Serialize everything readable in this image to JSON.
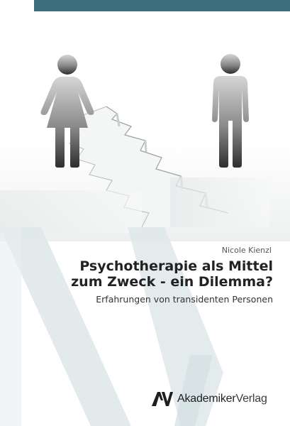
{
  "cover": {
    "author": "Nicole Kienzl",
    "title_line1": "Psychotherapie als Mittel",
    "title_line2": "zum Zweck - ein Dilemma?",
    "subtitle": "Erfahrungen von transidenten Personen",
    "publisher_part1": "Akademiker",
    "publisher_part2": "Verlag",
    "colors": {
      "top_bar": "#3a6f7b",
      "watermark": "#dfe8ea",
      "figure_gradient_top": "#d4d4d4",
      "figure_gradient_bottom": "#2e2e2e"
    },
    "illustration": {
      "subject": "female and male pictogram figures separated by a ground crack",
      "icons": [
        "female-figure-icon",
        "male-figure-icon",
        "crack-icon"
      ]
    }
  }
}
